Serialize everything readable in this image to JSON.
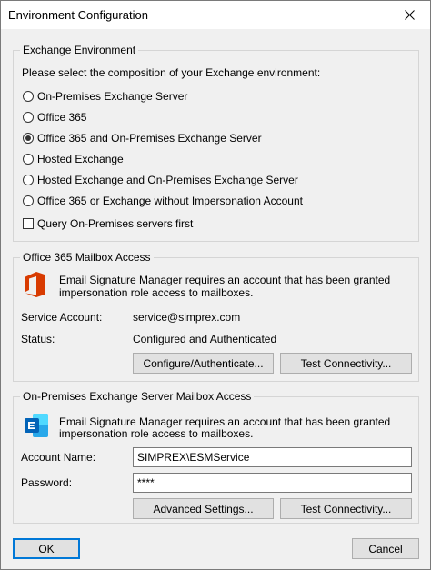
{
  "window": {
    "title": "Environment Configuration",
    "close_icon": "close-icon"
  },
  "exchange_env": {
    "legend": "Exchange Environment",
    "prompt": "Please select the composition of your Exchange environment:",
    "options": [
      {
        "label": "On-Premises Exchange Server",
        "checked": false
      },
      {
        "label": "Office 365",
        "checked": false
      },
      {
        "label": "Office 365 and On-Premises Exchange Server",
        "checked": true
      },
      {
        "label": "Hosted Exchange",
        "checked": false
      },
      {
        "label": "Hosted Exchange and On-Premises Exchange Server",
        "checked": false
      },
      {
        "label": "Office 365 or Exchange without Impersonation Account",
        "checked": false
      }
    ],
    "query_checkbox": {
      "label": "Query On-Premises servers first",
      "checked": false
    }
  },
  "o365": {
    "legend": "Office 365 Mailbox Access",
    "icon": "office-icon",
    "description_line1": "Email Signature Manager requires an account that has been granted",
    "description_line2": "impersonation role access to mailboxes.",
    "service_account_label": "Service Account:",
    "service_account_value": "service@simprex.com",
    "status_label": "Status:",
    "status_value": "Configured and Authenticated",
    "configure_button": "Configure/Authenticate...",
    "test_button": "Test Connectivity..."
  },
  "onprem": {
    "legend": "On-Premises Exchange Server Mailbox Access",
    "icon": "exchange-icon",
    "description_line1": "Email Signature Manager requires an account that has been granted",
    "description_line2": "impersonation role access to mailboxes.",
    "account_name_label": "Account Name:",
    "account_name_value": "SIMPREX\\ESMService",
    "password_label": "Password:",
    "password_value": "****",
    "advanced_button": "Advanced Settings...",
    "test_button": "Test Connectivity..."
  },
  "footer": {
    "ok_button": "OK",
    "cancel_button": "Cancel"
  },
  "colors": {
    "office_red": "#d83b01",
    "exchange_blue": "#0364b8",
    "default_button_border": "#0078d7"
  }
}
